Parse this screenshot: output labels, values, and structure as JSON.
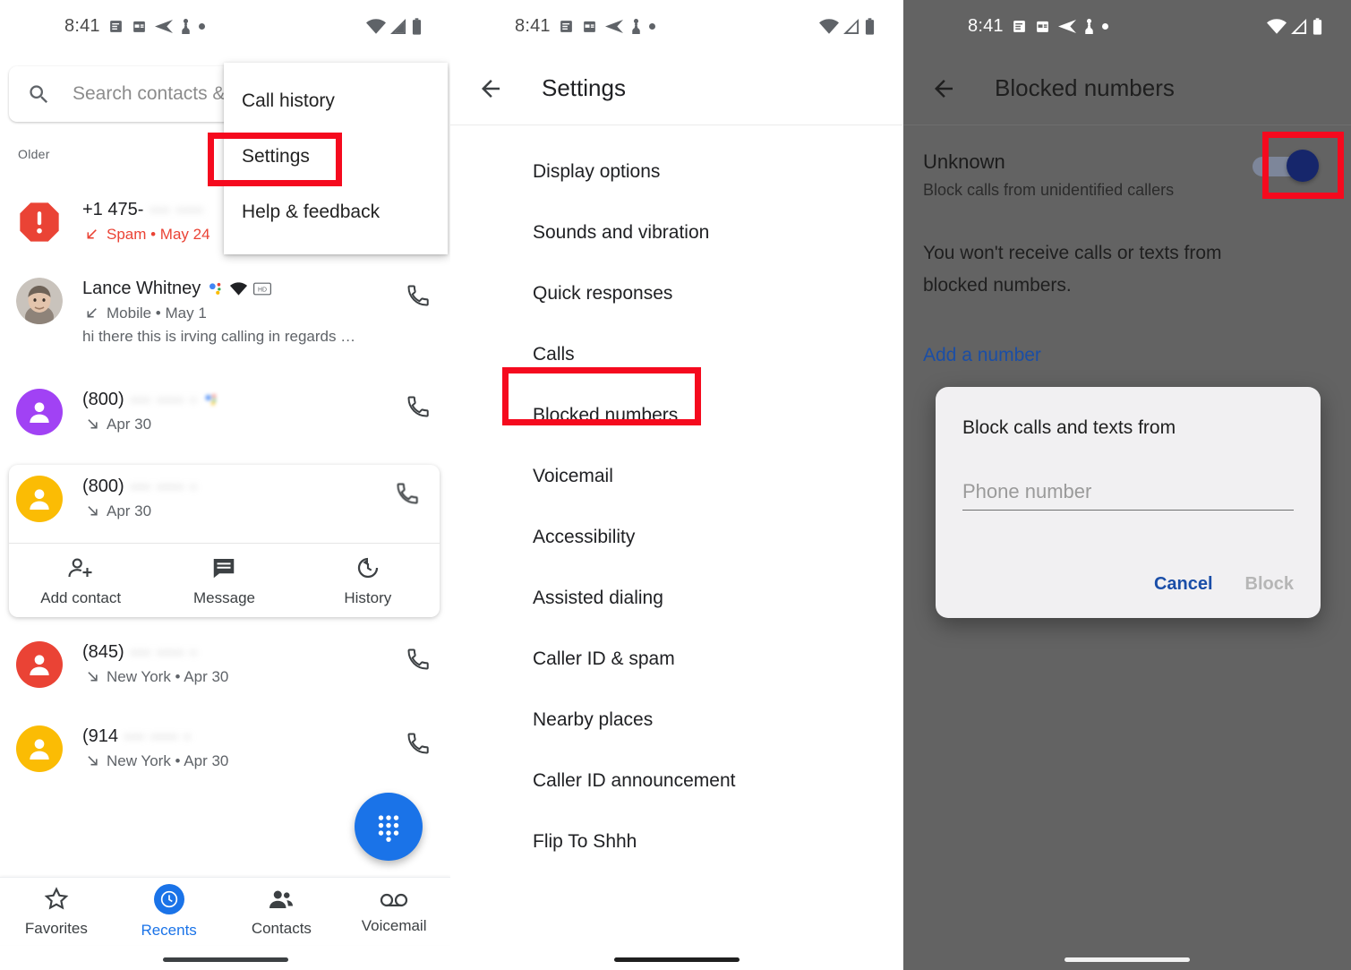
{
  "status_bar": {
    "time": "8:41",
    "left_icons": [
      "list-notification-icon",
      "calendar-icon",
      "send-icon",
      "person-icon",
      "dot-icon"
    ],
    "right_icons": [
      "wifi-icon",
      "cellular-signal-icon",
      "battery-icon"
    ]
  },
  "panel_recents": {
    "search": {
      "placeholder": "Search contacts &",
      "icon": "search-icon"
    },
    "overflow_menu": {
      "items": [
        {
          "label": "Call history"
        },
        {
          "label": "Settings",
          "highlighted": true
        },
        {
          "label": "Help & feedback"
        }
      ]
    },
    "section_label": "Older",
    "calls": [
      {
        "title": "+1 475-",
        "blurred": "--- ----",
        "subtitle": "Spam • May 24",
        "avatar": "spam-warning-icon",
        "is_spam": true,
        "direction_icon": "incoming-call-icon"
      },
      {
        "title": "Lance Whitney",
        "subtitle": "Mobile • May 1",
        "snippet": "hi there this is irving calling in regards …",
        "avatar": "contact-photo",
        "badges": [
          "assistant-icon",
          "wifi-calling-icon",
          "hd-icon"
        ],
        "direction_icon": "incoming-call-icon",
        "action_icon": "phone-icon"
      },
      {
        "title": "(800)",
        "blurred": "--- ---- -",
        "subtitle": "Apr 30",
        "avatar": "person-avatar-purple",
        "direction_icon": "outgoing-call-icon",
        "action_icon": "phone-icon"
      },
      {
        "title": "(800)",
        "blurred": "--- ---- -",
        "subtitle": "Apr 30",
        "avatar": "person-avatar-yellow",
        "expanded": true,
        "direction_icon": "outgoing-call-icon",
        "action_icon": "phone-icon"
      },
      {
        "title": "(845)",
        "blurred": "--- ---- -",
        "subtitle": "New York • Apr 30",
        "avatar": "person-avatar-red",
        "direction_icon": "outgoing-call-icon",
        "action_icon": "phone-icon"
      },
      {
        "title": "(914",
        "blurred": "--- ---- -",
        "subtitle": "New York • Apr 30",
        "avatar": "person-avatar-yellow",
        "direction_icon": "outgoing-call-icon",
        "action_icon": "phone-icon"
      }
    ],
    "expanded_actions": [
      {
        "label": "Add contact",
        "icon": "add-contact-icon"
      },
      {
        "label": "Message",
        "icon": "message-icon"
      },
      {
        "label": "History",
        "icon": "history-icon"
      }
    ],
    "fab": {
      "icon": "dialpad-icon",
      "color": "#1a73e8"
    },
    "bottom_nav": [
      {
        "label": "Favorites",
        "icon": "star-icon",
        "active": false
      },
      {
        "label": "Recents",
        "icon": "clock-icon",
        "active": true
      },
      {
        "label": "Contacts",
        "icon": "contacts-icon",
        "active": false
      },
      {
        "label": "Voicemail",
        "icon": "voicemail-icon",
        "active": false
      }
    ]
  },
  "panel_settings": {
    "title": "Settings",
    "back_icon": "back-arrow-icon",
    "items": [
      "Display options",
      "Sounds and vibration",
      "Quick responses",
      "Calls",
      "Blocked numbers",
      "Voicemail",
      "Accessibility",
      "Assisted dialing",
      "Caller ID & spam",
      "Nearby places",
      "Caller ID announcement",
      "Flip To Shhh"
    ],
    "highlighted_item": "Blocked numbers"
  },
  "panel_blocked": {
    "title": "Blocked numbers",
    "back_icon": "back-arrow-icon",
    "unknown": {
      "title": "Unknown",
      "subtitle": "Block calls from unidentified callers",
      "toggle_on": true
    },
    "description": "You won't receive calls or texts from blocked numbers.",
    "add_link": "Add a number",
    "dialog": {
      "title": "Block calls and texts from",
      "input_placeholder": "Phone number",
      "input_value": "",
      "cancel_label": "Cancel",
      "confirm_label": "Block"
    }
  },
  "annotations": {
    "highlight_color": "#f50a1e",
    "boxes": [
      "settings-menu-item",
      "blocked-numbers-setting",
      "unknown-callers-toggle"
    ]
  }
}
